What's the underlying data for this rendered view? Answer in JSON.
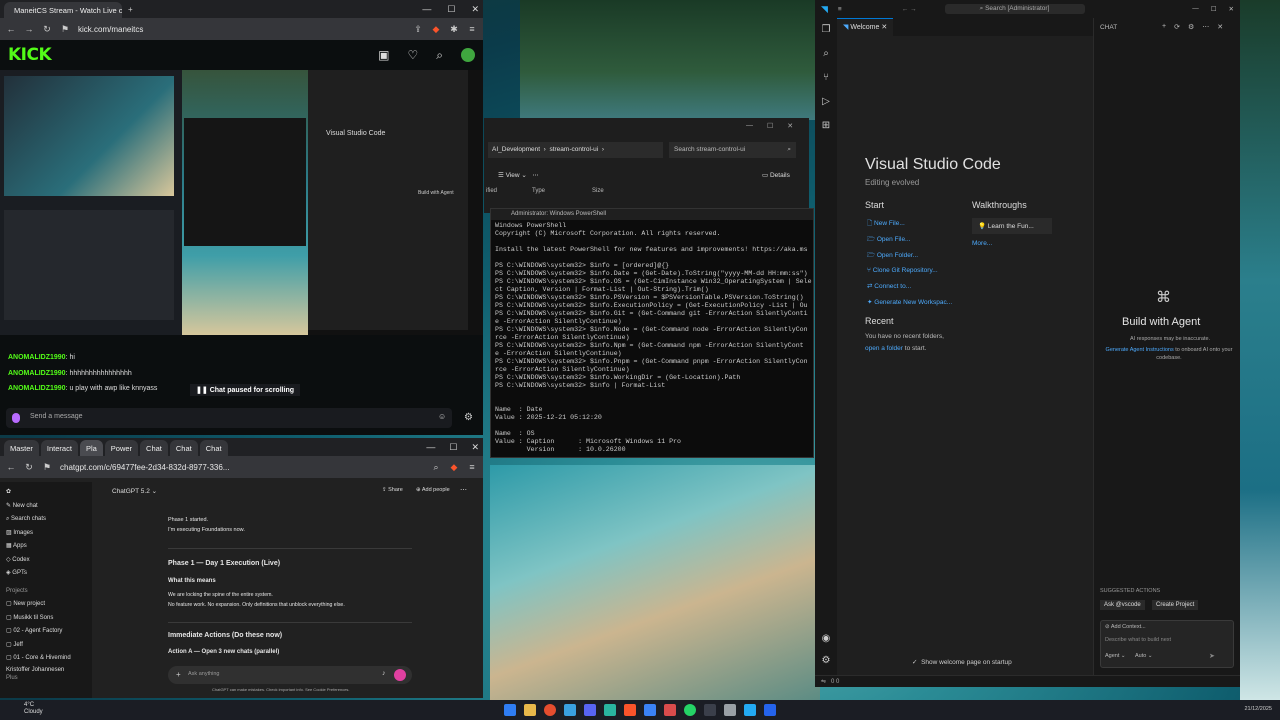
{
  "kick_browser": {
    "tab_title": "ManeitCS Stream - Watch Live c...",
    "url": "kick.com/maneitcs",
    "logo": "KICK",
    "chat": [
      {
        "user": "ANOMALIDZ1990",
        "msg": ": hi"
      },
      {
        "user": "ANOMALIDZ1990",
        "msg": ": hhhhhhhhhhhhhhhh"
      },
      {
        "user": "ANOMALIDZ1990",
        "msg": ": u play with awp like knnyass"
      }
    ],
    "paused_label": "Chat paused for scrolling",
    "send_placeholder": "Send a message",
    "nested": {
      "vscode_title": "Visual Studio Code",
      "build_label": "Build with Agent"
    }
  },
  "gpt_browser": {
    "tabs": [
      "Master",
      "Interact",
      "Pla",
      "Power",
      "Chat",
      "Chat",
      "Chat"
    ],
    "url": "chatgpt.com/c/69477fee-2d34-832d-8977-336...",
    "model": "ChatGPT 5.2",
    "share": "Share",
    "add_people": "Add people",
    "sidebar": [
      "New chat",
      "Search chats",
      "Images",
      "Apps",
      "Codex",
      "GPTs"
    ],
    "projects_label": "Projects",
    "projects": [
      "New project",
      "Musikk til Sons",
      "02 - Agent Factory",
      "Jeff",
      "01 - Core & Hivemind"
    ],
    "user": "Kristoffer Johannesen",
    "plan": "Plus",
    "msg1a": "Phase 1 started.",
    "msg1b": "I'm executing Foundations now.",
    "h1": "Phase 1 — Day 1 Execution (Live)",
    "h2": "What this means",
    "p1": "We are locking the spine of the entire system.",
    "p2": "No feature work. No expansion. Only definitions that unblock everything else.",
    "h3": "Immediate Actions (Do these now)",
    "h4": "Action A — Open 3 new chats (parallel)",
    "input_placeholder": "Ask anything",
    "disclaimer": "ChatGPT can make mistakes. Check important info. See Cookie Preferences."
  },
  "explorer": {
    "path": [
      "AI_Development",
      "stream-control-ui"
    ],
    "search": "Search stream-control-ui",
    "view": "View",
    "details": "Details",
    "cols": [
      "ified",
      "Type",
      "Size"
    ]
  },
  "powershell": {
    "title": "Administrator: Windows PowerShell",
    "lines": [
      "Windows PowerShell",
      "Copyright (C) Microsoft Corporation. All rights reserved.",
      "",
      "Install the latest PowerShell for new features and improvements! https://aka.ms",
      "",
      "PS C:\\WINDOWS\\system32> $info = [ordered]@{}",
      "PS C:\\WINDOWS\\system32> $info.Date = (Get-Date).ToString(\"yyyy-MM-dd HH:mm:ss\")",
      "PS C:\\WINDOWS\\system32> $info.OS = (Get-CimInstance Win32_OperatingSystem | Sele",
      "ct Caption, Version | Format-List | Out-String).Trim()",
      "PS C:\\WINDOWS\\system32> $info.PSVersion = $PSVersionTable.PSVersion.ToString()",
      "PS C:\\WINDOWS\\system32> $info.ExecutionPolicy = (Get-ExecutionPolicy -List | Ou",
      "PS C:\\WINDOWS\\system32> $info.Git = (Get-Command git -ErrorAction SilentlyConti",
      "e -ErrorAction SilentlyContinue)",
      "PS C:\\WINDOWS\\system32> $info.Node = (Get-Command node -ErrorAction SilentlyCon",
      "rce -ErrorAction SilentlyContinue)",
      "PS C:\\WINDOWS\\system32> $info.Npm = (Get-Command npm -ErrorAction SilentlyCont",
      "e -ErrorAction SilentlyContinue)",
      "PS C:\\WINDOWS\\system32> $info.Pnpm = (Get-Command pnpm -ErrorAction SilentlyCon",
      "rce -ErrorAction SilentlyContinue)",
      "PS C:\\WINDOWS\\system32> $info.WorkingDir = (Get-Location).Path",
      "PS C:\\WINDOWS\\system32> $info | Format-List",
      "",
      "",
      "Name  : Date",
      "Value : 2025-12-21 05:12:20",
      "",
      "Name  : OS",
      "Value : Caption      : Microsoft Windows 11 Pro",
      "        Version      : 10.0.26200"
    ]
  },
  "vscode": {
    "search": "Search [Administrator]",
    "tab": "Welcome",
    "title": "Visual Studio Code",
    "subtitle": "Editing evolved",
    "start_label": "Start",
    "start": [
      "New File...",
      "Open File...",
      "Open Folder...",
      "Clone Git Repository...",
      "Connect to...",
      "Generate New Workspac..."
    ],
    "walk_label": "Walkthroughs",
    "walk_item": "Learn the Fun...",
    "more": "More...",
    "recent_label": "Recent",
    "recent_text": "You have no recent folders,",
    "recent_link": "open a folder",
    "recent_end": "to start.",
    "show_welcome": "Show welcome page on startup",
    "chat_label": "CHAT",
    "build": "Build with Agent",
    "ai_note": "AI responses may be inaccurate.",
    "gen_link": "Generate Agent Instructions",
    "gen_rest": "to onboard AI onto your codebase.",
    "suggested": "SUGGESTED ACTIONS",
    "ask_btn": "Ask @vscode",
    "create_btn": "Create Project",
    "add_context": "Add Context...",
    "describe": "Describe what to build next",
    "agent": "Agent",
    "auto": "Auto",
    "status_nums": "0  0"
  },
  "taskbar": {
    "weather_temp": "4°C",
    "weather_desc": "Cloudy",
    "clock_date": "21/12/2025"
  }
}
